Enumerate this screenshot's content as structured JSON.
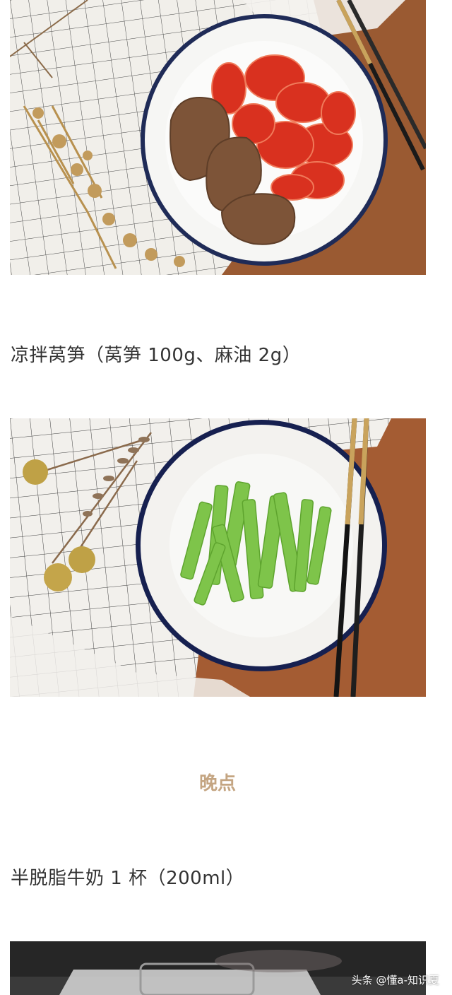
{
  "photos": [
    {
      "alt": "牛肉番茄",
      "icon": "plate-beef-tomato-image"
    },
    {
      "alt": "凉拌莴笋",
      "icon": "plate-lettuce-image"
    },
    {
      "alt": "牛奶",
      "icon": "milk-glass-image"
    }
  ],
  "captions": {
    "lettuce": "凉拌莴笋（莴笋 100g、麻油 2g）",
    "milk": "半脱脂牛奶 1 杯（200ml）"
  },
  "sections": {
    "evening_snack": "晚点"
  },
  "watermark": "头条 @懂a-知识夏",
  "colors": {
    "section_title": "#c4a582",
    "caption_text": "#333333"
  }
}
